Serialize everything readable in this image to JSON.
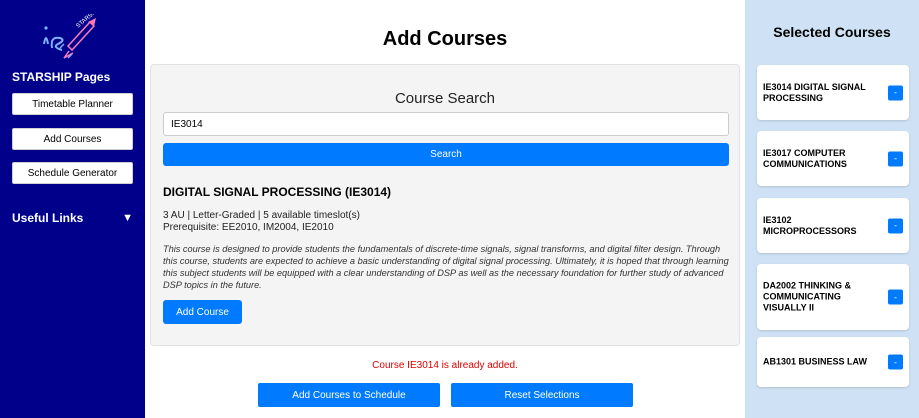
{
  "sidebar": {
    "logo_text": "STARSHIP",
    "heading": "STARSHIP Pages",
    "buttons": [
      {
        "label": "Timetable Planner"
      },
      {
        "label": "Add Courses"
      },
      {
        "label": "Schedule Generator"
      }
    ],
    "useful_links": {
      "label": "Useful Links",
      "caret": "▼"
    }
  },
  "main": {
    "title": "Add Courses",
    "search": {
      "heading": "Course Search",
      "input_value": "IE3014",
      "button_label": "Search"
    },
    "course": {
      "title": "DIGITAL SIGNAL PROCESSING (IE3014)",
      "meta": "3 AU | Letter-Graded | 5 available timeslot(s)",
      "prerequisite": "Prerequisite: EE2010, IM2004, IE2010",
      "description": "This course is designed to provide students the fundamentals of discrete-time signals, signal transforms, and digital filter design. Through this course, students are expected to achieve a basic understanding of digital signal processing. Ultimately, it is hoped that through learning this subject students will be equipped with a clear understanding of DSP as well as the necessary foundation for further study of advanced DSP topics in the future.",
      "add_button_label": "Add Course"
    },
    "error_message": "Course IE3014 is already added.",
    "bottom_buttons": {
      "add_to_schedule": "Add Courses to Schedule",
      "reset": "Reset Selections"
    }
  },
  "selected": {
    "title": "Selected Courses",
    "items": [
      {
        "label": "IE3014 DIGITAL SIGNAL PROCESSING",
        "remove": "-"
      },
      {
        "label": "IE3017 COMPUTER COMMUNICATIONS",
        "remove": "-"
      },
      {
        "label": "IE3102 MICROPROCESSORS",
        "remove": "-"
      },
      {
        "label": "DA2002 THINKING & COMMUNICATING VISUALLY II",
        "remove": "-"
      },
      {
        "label": "AB1301 BUSINESS LAW",
        "remove": "-"
      }
    ]
  },
  "colors": {
    "sidebar_bg": "#00008b",
    "accent": "#007bff",
    "right_panel_bg": "#cfe2f5",
    "error": "#e00000"
  }
}
